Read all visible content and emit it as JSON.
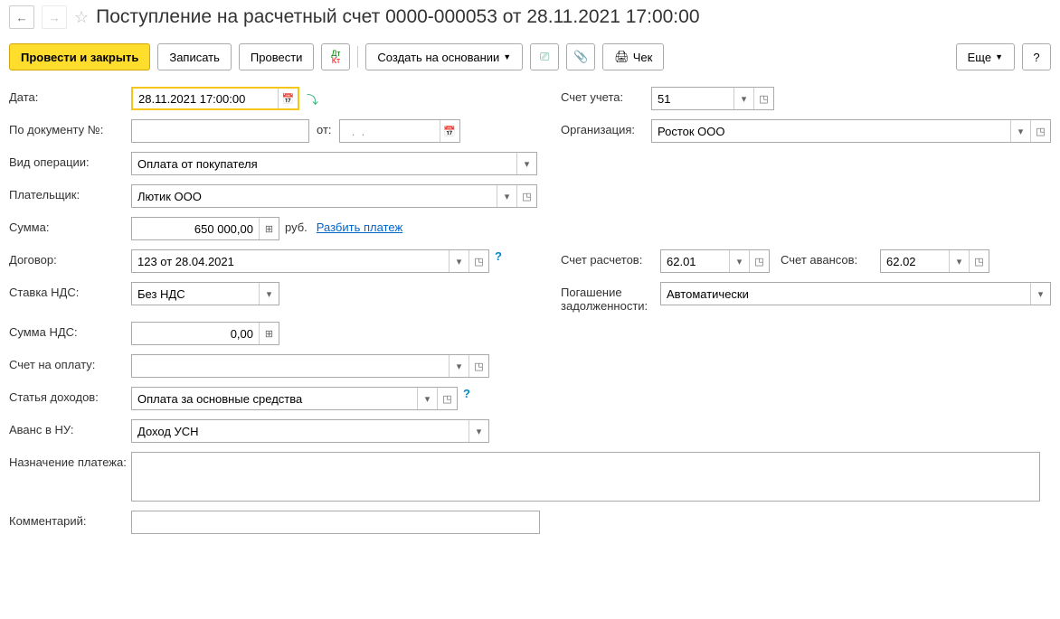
{
  "header": {
    "title": "Поступление на расчетный счет 0000-000053 от 28.11.2021 17:00:00"
  },
  "toolbar": {
    "post_close": "Провести и закрыть",
    "save": "Записать",
    "post": "Провести",
    "create_based": "Создать на основании",
    "receipt": "Чек",
    "more": "Еще",
    "help": "?"
  },
  "form": {
    "date_label": "Дата:",
    "date_value": "28.11.2021 17:00:00",
    "account_label": "Счет учета:",
    "account_value": "51",
    "doc_no_label": "По документу №:",
    "doc_no_value": "",
    "from_label": "от:",
    "from_value": "  .  .    ",
    "org_label": "Организация:",
    "org_value": "Росток ООО",
    "op_type_label": "Вид операции:",
    "op_type_value": "Оплата от покупателя",
    "payer_label": "Плательщик:",
    "payer_value": "Лютик ООО",
    "sum_label": "Сумма:",
    "sum_value": "650 000,00",
    "currency": "руб.",
    "split_payment": "Разбить платеж",
    "contract_label": "Договор:",
    "contract_value": "123 от 28.04.2021",
    "settle_acc_label": "Счет расчетов:",
    "settle_acc_value": "62.01",
    "advance_acc_label": "Счет авансов:",
    "advance_acc_value": "62.02",
    "vat_rate_label": "Ставка НДС:",
    "vat_rate_value": "Без НДС",
    "debt_repay_label": "Погашение задолженности:",
    "debt_repay_value": "Автоматически",
    "vat_sum_label": "Сумма НДС:",
    "vat_sum_value": "0,00",
    "invoice_label": "Счет на оплату:",
    "invoice_value": "",
    "income_item_label": "Статья доходов:",
    "income_item_value": "Оплата за основные средства",
    "advance_nu_label": "Аванс в НУ:",
    "advance_nu_value": "Доход УСН",
    "purpose_label": "Назначение платежа:",
    "purpose_value": "",
    "comment_label": "Комментарий:",
    "comment_value": ""
  }
}
